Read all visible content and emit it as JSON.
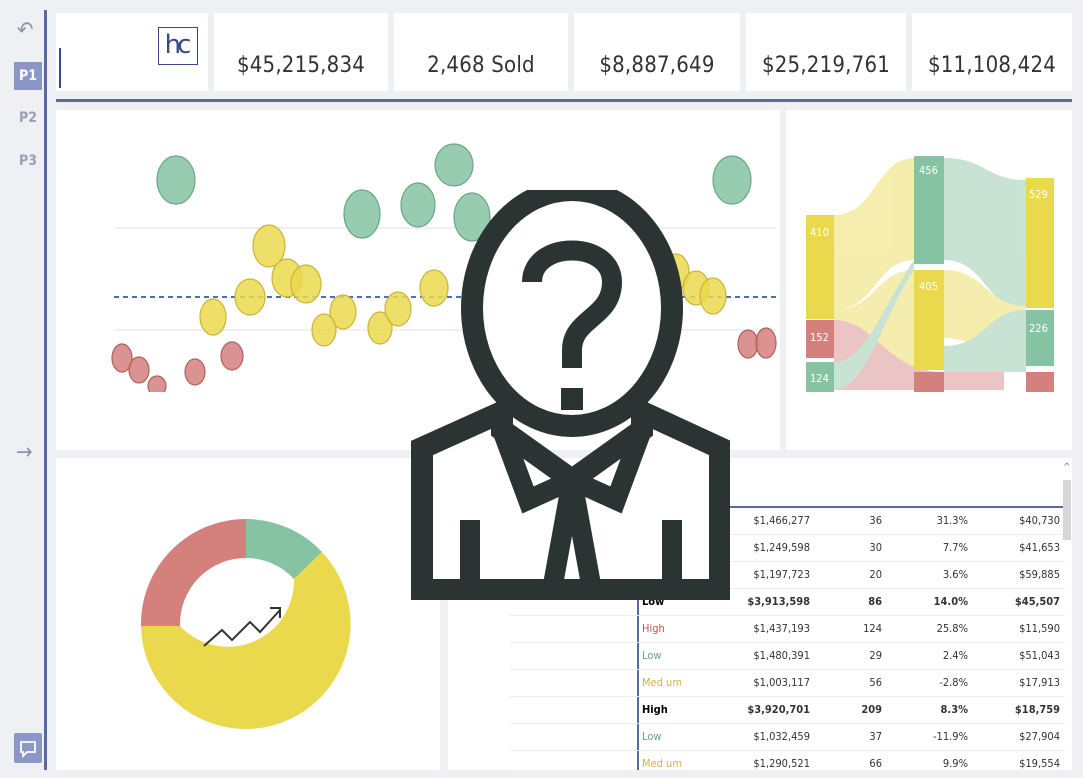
{
  "nav": {
    "back_icon": "undo-icon",
    "pages": [
      "P1",
      "P2",
      "P3"
    ],
    "active_page": "P1",
    "next_icon": "arrow-right-icon",
    "comment_icon": "chat-icon"
  },
  "kpis": [
    {
      "value": "$45,215,834"
    },
    {
      "value": "2,468 Sold"
    },
    {
      "value": "$8,887,649"
    },
    {
      "value": "$25,219,761"
    },
    {
      "value": "$11,108,424"
    }
  ],
  "colors": {
    "green": "#86c3a2",
    "yellow": "#ead94d",
    "red": "#d4807c",
    "accent": "#5b6a9a"
  },
  "sankey": {
    "left": [
      {
        "label": "410"
      },
      {
        "label": "152"
      },
      {
        "label": "124"
      }
    ],
    "middle": [
      {
        "label": "456"
      },
      {
        "label": "405"
      }
    ],
    "right": [
      {
        "label": "529"
      },
      {
        "label": "226"
      }
    ]
  },
  "table": {
    "rows": [
      {
        "segment": "",
        "sales": "$1,466,277",
        "count": "36",
        "pct": "31.3%",
        "avg": "$40,730"
      },
      {
        "segment": "",
        "sales": "$1,249,598",
        "count": "30",
        "pct": "7.7%",
        "avg": "$41,653"
      },
      {
        "segment": "",
        "sales": "$1,197,723",
        "count": "20",
        "pct": "3.6%",
        "avg": "$59,885"
      },
      {
        "segment": "Low",
        "sales": "$3,913,598",
        "count": "86",
        "pct": "14.0%",
        "avg": "$45,507",
        "bold": true
      },
      {
        "segment": "High",
        "sales": "$1,437,193",
        "count": "124",
        "pct": "25.8%",
        "avg": "$11,590"
      },
      {
        "segment": "Low",
        "sales": "$1,480,391",
        "count": "29",
        "pct": "2.4%",
        "avg": "$51,043"
      },
      {
        "segment": "Med um",
        "sales": "$1,003,117",
        "count": "56",
        "pct": "-2.8%",
        "avg": "$17,913"
      },
      {
        "segment": "High",
        "sales": "$3,920,701",
        "count": "209",
        "pct": "8.3%",
        "avg": "$18,759",
        "bold": true
      },
      {
        "segment": "Low",
        "sales": "$1,032,459",
        "count": "37",
        "pct": "-11.9%",
        "avg": "$27,904"
      },
      {
        "segment": "Med um",
        "sales": "$1,290,521",
        "count": "66",
        "pct": "9.9%",
        "avg": "$19,554"
      }
    ]
  },
  "overlay_icon": "unknown-person-icon",
  "donut_icon": "trend-up-icon"
}
